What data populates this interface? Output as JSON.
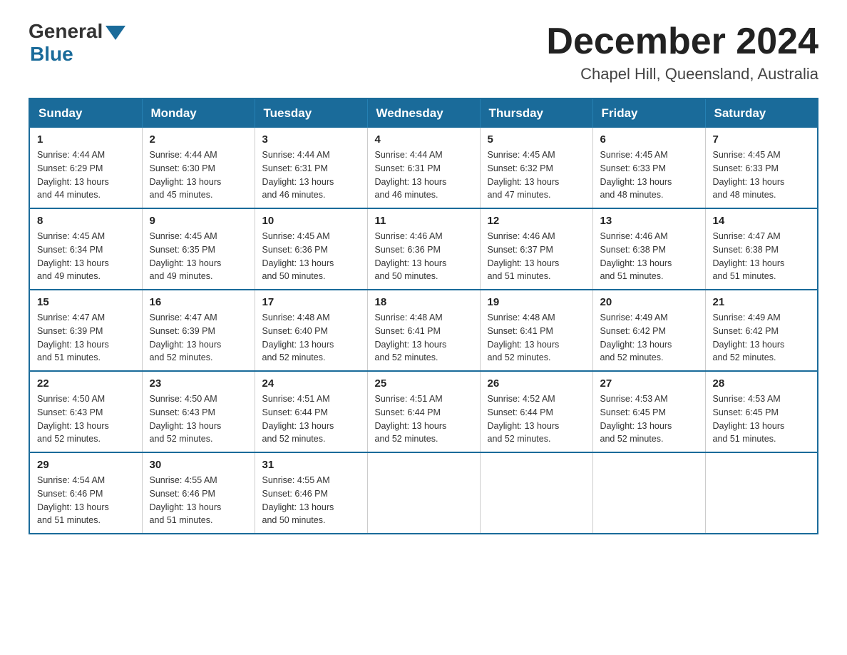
{
  "logo": {
    "general": "General",
    "blue": "Blue"
  },
  "title": "December 2024",
  "subtitle": "Chapel Hill, Queensland, Australia",
  "days_of_week": [
    "Sunday",
    "Monday",
    "Tuesday",
    "Wednesday",
    "Thursday",
    "Friday",
    "Saturday"
  ],
  "weeks": [
    [
      {
        "day": "1",
        "sunrise": "4:44 AM",
        "sunset": "6:29 PM",
        "daylight": "13 hours and 44 minutes."
      },
      {
        "day": "2",
        "sunrise": "4:44 AM",
        "sunset": "6:30 PM",
        "daylight": "13 hours and 45 minutes."
      },
      {
        "day": "3",
        "sunrise": "4:44 AM",
        "sunset": "6:31 PM",
        "daylight": "13 hours and 46 minutes."
      },
      {
        "day": "4",
        "sunrise": "4:44 AM",
        "sunset": "6:31 PM",
        "daylight": "13 hours and 46 minutes."
      },
      {
        "day": "5",
        "sunrise": "4:45 AM",
        "sunset": "6:32 PM",
        "daylight": "13 hours and 47 minutes."
      },
      {
        "day": "6",
        "sunrise": "4:45 AM",
        "sunset": "6:33 PM",
        "daylight": "13 hours and 48 minutes."
      },
      {
        "day": "7",
        "sunrise": "4:45 AM",
        "sunset": "6:33 PM",
        "daylight": "13 hours and 48 minutes."
      }
    ],
    [
      {
        "day": "8",
        "sunrise": "4:45 AM",
        "sunset": "6:34 PM",
        "daylight": "13 hours and 49 minutes."
      },
      {
        "day": "9",
        "sunrise": "4:45 AM",
        "sunset": "6:35 PM",
        "daylight": "13 hours and 49 minutes."
      },
      {
        "day": "10",
        "sunrise": "4:45 AM",
        "sunset": "6:36 PM",
        "daylight": "13 hours and 50 minutes."
      },
      {
        "day": "11",
        "sunrise": "4:46 AM",
        "sunset": "6:36 PM",
        "daylight": "13 hours and 50 minutes."
      },
      {
        "day": "12",
        "sunrise": "4:46 AM",
        "sunset": "6:37 PM",
        "daylight": "13 hours and 51 minutes."
      },
      {
        "day": "13",
        "sunrise": "4:46 AM",
        "sunset": "6:38 PM",
        "daylight": "13 hours and 51 minutes."
      },
      {
        "day": "14",
        "sunrise": "4:47 AM",
        "sunset": "6:38 PM",
        "daylight": "13 hours and 51 minutes."
      }
    ],
    [
      {
        "day": "15",
        "sunrise": "4:47 AM",
        "sunset": "6:39 PM",
        "daylight": "13 hours and 51 minutes."
      },
      {
        "day": "16",
        "sunrise": "4:47 AM",
        "sunset": "6:39 PM",
        "daylight": "13 hours and 52 minutes."
      },
      {
        "day": "17",
        "sunrise": "4:48 AM",
        "sunset": "6:40 PM",
        "daylight": "13 hours and 52 minutes."
      },
      {
        "day": "18",
        "sunrise": "4:48 AM",
        "sunset": "6:41 PM",
        "daylight": "13 hours and 52 minutes."
      },
      {
        "day": "19",
        "sunrise": "4:48 AM",
        "sunset": "6:41 PM",
        "daylight": "13 hours and 52 minutes."
      },
      {
        "day": "20",
        "sunrise": "4:49 AM",
        "sunset": "6:42 PM",
        "daylight": "13 hours and 52 minutes."
      },
      {
        "day": "21",
        "sunrise": "4:49 AM",
        "sunset": "6:42 PM",
        "daylight": "13 hours and 52 minutes."
      }
    ],
    [
      {
        "day": "22",
        "sunrise": "4:50 AM",
        "sunset": "6:43 PM",
        "daylight": "13 hours and 52 minutes."
      },
      {
        "day": "23",
        "sunrise": "4:50 AM",
        "sunset": "6:43 PM",
        "daylight": "13 hours and 52 minutes."
      },
      {
        "day": "24",
        "sunrise": "4:51 AM",
        "sunset": "6:44 PM",
        "daylight": "13 hours and 52 minutes."
      },
      {
        "day": "25",
        "sunrise": "4:51 AM",
        "sunset": "6:44 PM",
        "daylight": "13 hours and 52 minutes."
      },
      {
        "day": "26",
        "sunrise": "4:52 AM",
        "sunset": "6:44 PM",
        "daylight": "13 hours and 52 minutes."
      },
      {
        "day": "27",
        "sunrise": "4:53 AM",
        "sunset": "6:45 PM",
        "daylight": "13 hours and 52 minutes."
      },
      {
        "day": "28",
        "sunrise": "4:53 AM",
        "sunset": "6:45 PM",
        "daylight": "13 hours and 51 minutes."
      }
    ],
    [
      {
        "day": "29",
        "sunrise": "4:54 AM",
        "sunset": "6:46 PM",
        "daylight": "13 hours and 51 minutes."
      },
      {
        "day": "30",
        "sunrise": "4:55 AM",
        "sunset": "6:46 PM",
        "daylight": "13 hours and 51 minutes."
      },
      {
        "day": "31",
        "sunrise": "4:55 AM",
        "sunset": "6:46 PM",
        "daylight": "13 hours and 50 minutes."
      },
      null,
      null,
      null,
      null
    ]
  ]
}
